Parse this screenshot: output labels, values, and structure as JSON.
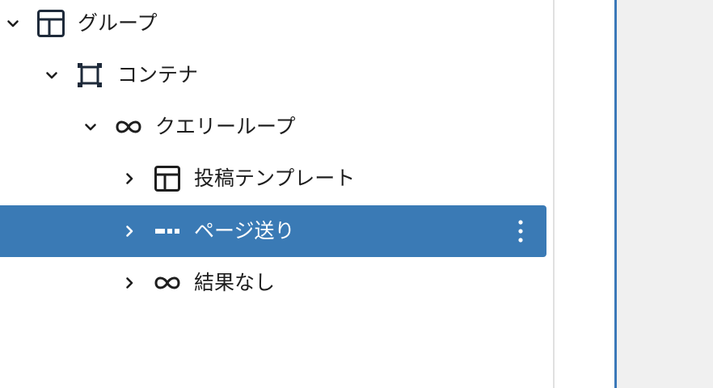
{
  "list_view": {
    "items": [
      {
        "label": "グループ",
        "icon": "group-layout-icon",
        "expanded": true
      },
      {
        "label": "コンテナ",
        "icon": "container-icon",
        "expanded": true
      },
      {
        "label": "クエリーループ",
        "icon": "loop-icon",
        "expanded": true
      },
      {
        "label": "投稿テンプレート",
        "icon": "post-template-layout-icon",
        "expanded": false
      },
      {
        "label": "ページ送り",
        "icon": "pagination-icon",
        "expanded": false,
        "selected": true
      },
      {
        "label": "結果なし",
        "icon": "loop-icon",
        "expanded": false
      }
    ],
    "options_icon": "vertical-ellipsis-icon"
  },
  "colors": {
    "selected_background": "#3a7ab5",
    "text": "#1e1e1e",
    "icon_dark": "#1e2a3a",
    "canvas_background": "#f0f0f0",
    "canvas_edge": "#3a78b8"
  }
}
